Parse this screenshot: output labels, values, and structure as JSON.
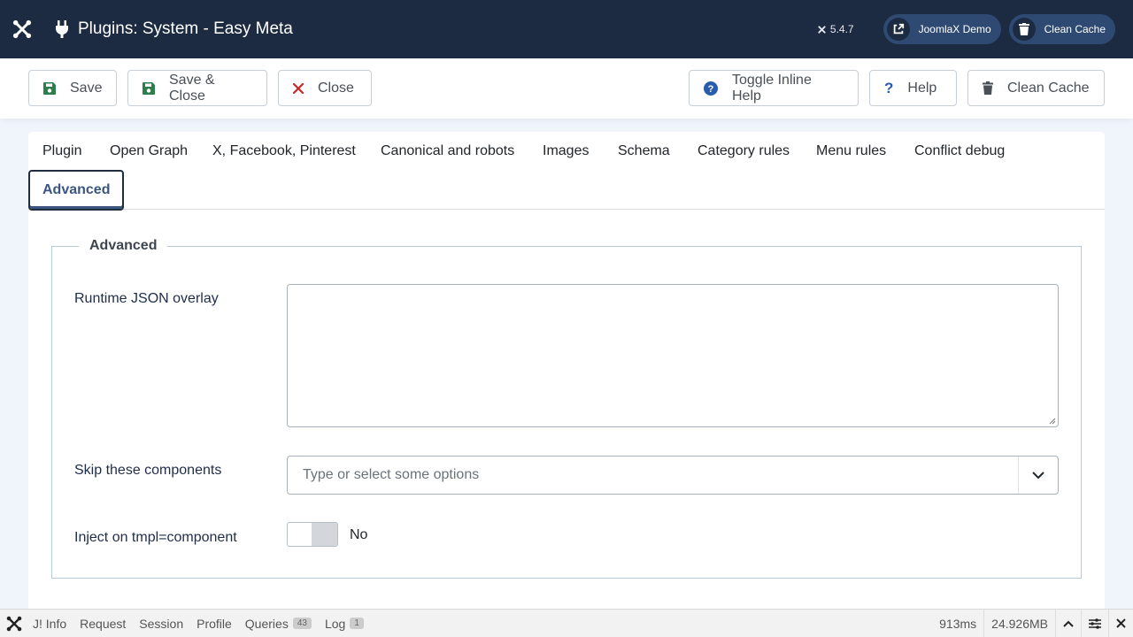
{
  "header": {
    "title": "Plugins: System - Easy Meta",
    "version": "5.4.7",
    "site_button": "JoomlaX Demo",
    "cache_button": "Clean Cache"
  },
  "toolbar": {
    "save": "Save",
    "save_close": "Save & Close",
    "close": "Close",
    "toggle_help": "Toggle Inline Help",
    "help": "Help",
    "clean_cache": "Clean Cache"
  },
  "tabs": [
    "Plugin",
    "Open Graph",
    "X, Facebook, Pinterest",
    "Canonical and robots",
    "Images",
    "Schema",
    "Category rules",
    "Menu rules",
    "Conflict debug",
    "Advanced"
  ],
  "active_tab": "Advanced",
  "fieldset": {
    "legend": "Advanced",
    "json_label": "Runtime JSON overlay",
    "json_value": "",
    "skip_label": "Skip these components",
    "skip_placeholder": "Type or select some options",
    "inject_label": "Inject on tmpl=component",
    "inject_value": "No"
  },
  "debugbar": {
    "info": "J! Info",
    "request": "Request",
    "session": "Session",
    "profile": "Profile",
    "queries": "Queries",
    "queries_count": "43",
    "log": "Log",
    "log_count": "1",
    "time": "913ms",
    "memory": "24.926MB"
  },
  "colors": {
    "header_bg": "#1c2b41",
    "accent": "#3b5780",
    "save_icon": "#2e7d4e",
    "close_icon": "#c52827",
    "help_icon": "#2a5cad"
  }
}
